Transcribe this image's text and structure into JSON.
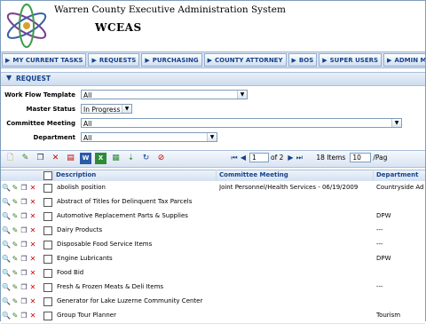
{
  "header": {
    "system_title": "Warren County Executive Administration System",
    "system_abbr": "WCEAS"
  },
  "nav": {
    "items": [
      {
        "label": "MY CURRENT TASKS"
      },
      {
        "label": "REQUESTS"
      },
      {
        "label": "PURCHASING"
      },
      {
        "label": "COUNTY ATTORNEY"
      },
      {
        "label": "BOS"
      },
      {
        "label": "SUPER USERS"
      },
      {
        "label": "ADMIN ME"
      }
    ]
  },
  "panel": {
    "title": "REQUEST"
  },
  "filters": {
    "workflow_label": "Work Flow Template",
    "workflow_value": "All",
    "master_status_label": "Master Status",
    "master_status_value": "In Progress",
    "committee_label": "Committee Meeting",
    "committee_value": "All",
    "department_label": "Department",
    "department_value": "All"
  },
  "pager": {
    "page": "1",
    "of_text": "of 2",
    "items_text": "18 Items",
    "page_size": "10",
    "page_label": "/Pag"
  },
  "grid": {
    "columns": [
      "Description",
      "Committee Meeting",
      "Department"
    ],
    "rows": [
      {
        "description": "abolish position",
        "committee": "Joint Personnel/Health Services - 06/19/2009",
        "department": "Countryside Ad"
      },
      {
        "description": "Abstract of Titles for Delinquent Tax Parcels",
        "committee": "",
        "department": ""
      },
      {
        "description": "Automotive Replacement Parts & Supplies",
        "committee": "",
        "department": "DPW"
      },
      {
        "description": "Dairy Products",
        "committee": "",
        "department": "---"
      },
      {
        "description": "Disposable Food Service Items",
        "committee": "",
        "department": "---"
      },
      {
        "description": "Engine Lubricants",
        "committee": "",
        "department": "DPW"
      },
      {
        "description": "Food Bid",
        "committee": "",
        "department": ""
      },
      {
        "description": "Fresh & Frozen Meats & Deli Items",
        "committee": "",
        "department": "---"
      },
      {
        "description": "Generator for Lake Luzerne Community Center",
        "committee": "",
        "department": ""
      },
      {
        "description": "Group Tour Planner",
        "committee": "",
        "department": "Tourism"
      }
    ]
  },
  "colors": {
    "accent": "#15428b",
    "nav_bg": "#d6e3f2"
  }
}
